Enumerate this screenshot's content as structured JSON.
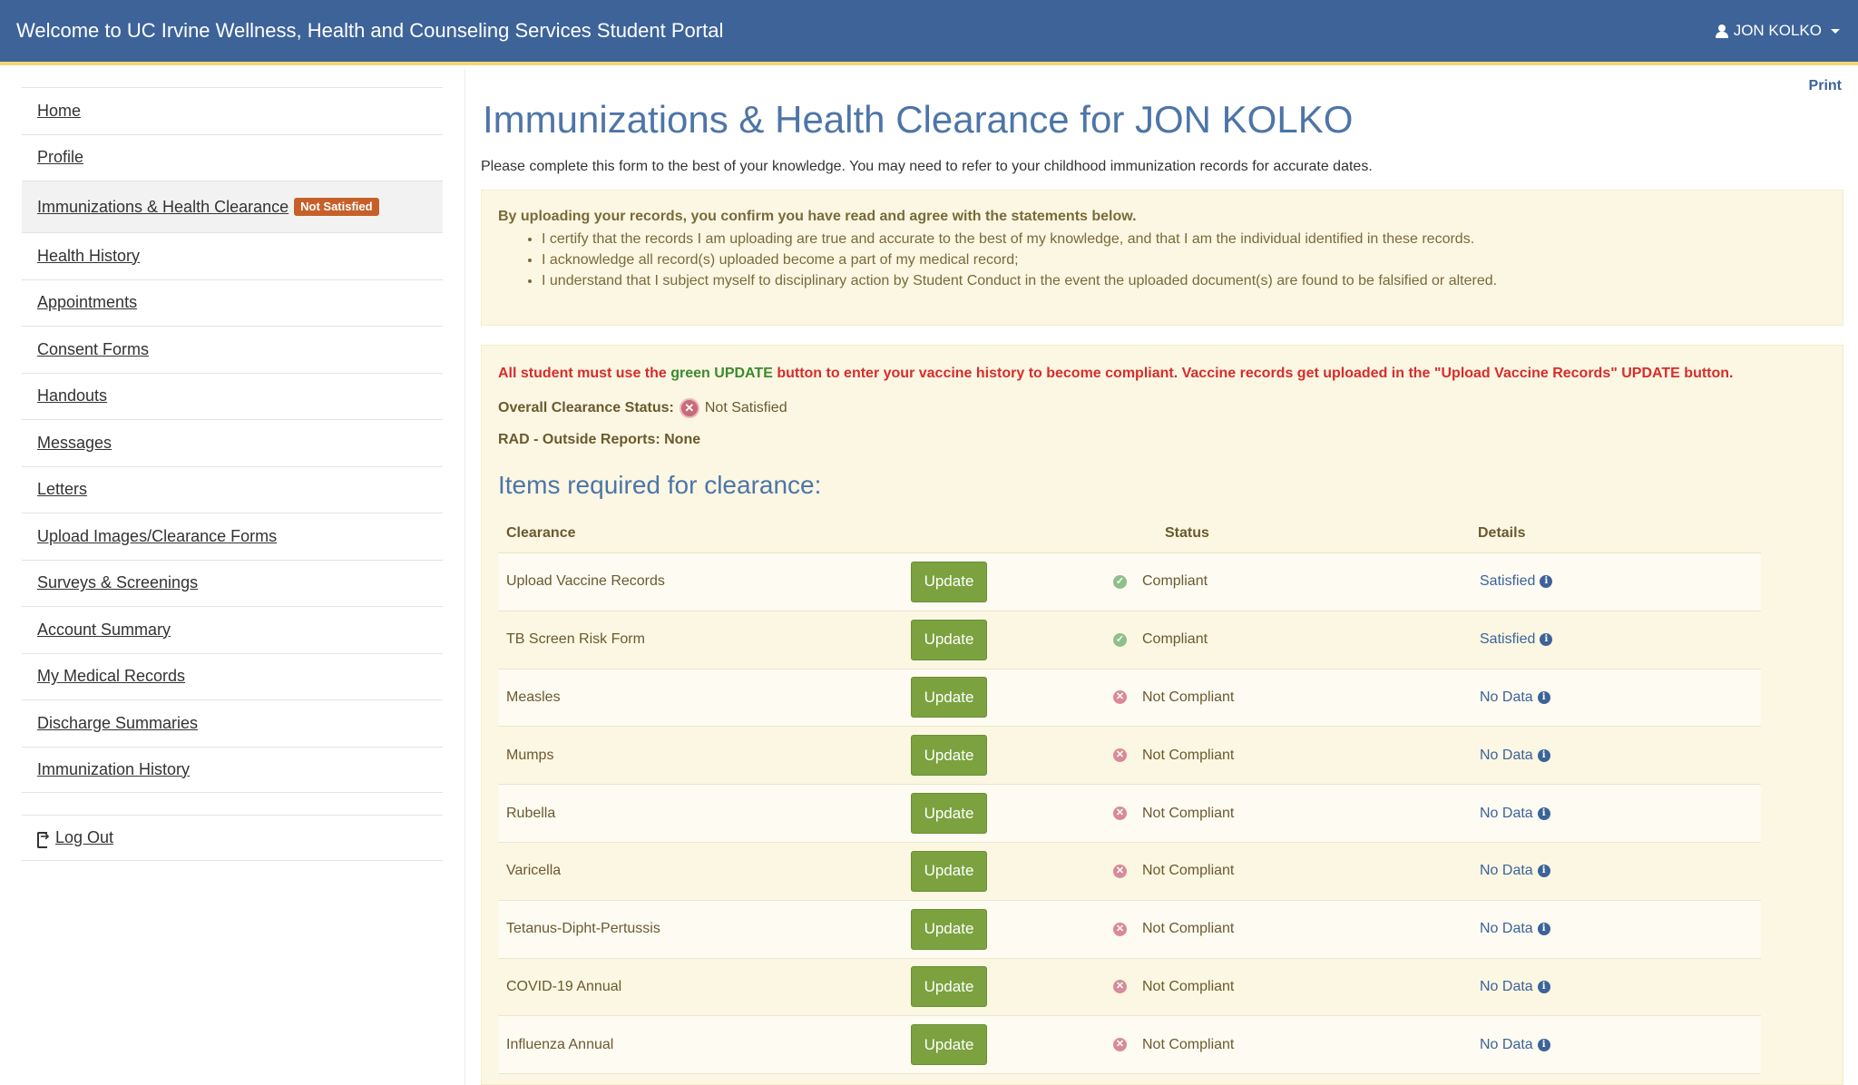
{
  "header": {
    "title": "Welcome to UC Irvine Wellness, Health and Counseling Services Student Portal",
    "user": "JON KOLKO"
  },
  "sidebar": {
    "items": [
      {
        "label": "Home"
      },
      {
        "label": "Profile"
      },
      {
        "label": "Immunizations & Health Clearance",
        "badge": "Not Satisfied"
      },
      {
        "label": "Health History"
      },
      {
        "label": "Appointments"
      },
      {
        "label": "Consent Forms"
      },
      {
        "label": "Handouts"
      },
      {
        "label": "Messages"
      },
      {
        "label": "Letters"
      },
      {
        "label": "Upload Images/Clearance Forms"
      },
      {
        "label": "Surveys & Screenings"
      },
      {
        "label": "Account Summary"
      },
      {
        "label": "My Medical Records"
      },
      {
        "label": "Discharge Summaries"
      },
      {
        "label": "Immunization History"
      }
    ],
    "logout": "Log Out"
  },
  "main": {
    "print": "Print",
    "title": "Immunizations & Health Clearance for JON KOLKO",
    "intro": "Please complete this form to the best of your knowledge. You may need to refer to your childhood immunization records for accurate dates.",
    "agree": {
      "head": "By uploading your records, you confirm you have read and agree with the statements below.",
      "bullets": [
        "I certify that the records I am uploading are true and accurate to the best of my knowledge, and that I am the individual identified in these records.",
        "I acknowledge all record(s) uploaded become a part of my medical record;",
        "I understand that I subject myself to disciplinary action by Student Conduct in the event the uploaded document(s) are found to be falsified or altered."
      ]
    },
    "alert": {
      "part1": "All student must use the",
      "green": "green UPDATE",
      "part2": "button to enter your vaccine history to become compliant. Vaccine records get uploaded in the \"Upload Vaccine Records\" UPDATE button."
    },
    "overall_label": "Overall Clearance Status:",
    "overall_value": "Not Satisfied",
    "rad": "RAD - Outside Reports: None",
    "items_title": "Items required for clearance:",
    "table": {
      "headers": {
        "clearance": "Clearance",
        "status": "Status",
        "details": "Details"
      },
      "button_label": "Update",
      "rows": [
        {
          "name": "Upload Vaccine Records",
          "status": "Compliant",
          "ok": true,
          "details": "Satisfied"
        },
        {
          "name": "TB Screen Risk Form",
          "status": "Compliant",
          "ok": true,
          "details": "Satisfied"
        },
        {
          "name": "Measles",
          "status": "Not Compliant",
          "ok": false,
          "details": "No Data"
        },
        {
          "name": "Mumps",
          "status": "Not Compliant",
          "ok": false,
          "details": "No Data"
        },
        {
          "name": "Rubella",
          "status": "Not Compliant",
          "ok": false,
          "details": "No Data"
        },
        {
          "name": "Varicella",
          "status": "Not Compliant",
          "ok": false,
          "details": "No Data"
        },
        {
          "name": "Tetanus-Dipht-Pertussis",
          "status": "Not Compliant",
          "ok": false,
          "details": "No Data"
        },
        {
          "name": "COVID-19 Annual",
          "status": "Not Compliant",
          "ok": false,
          "details": "No Data"
        },
        {
          "name": "Influenza Annual",
          "status": "Not Compliant",
          "ok": false,
          "details": "No Data"
        }
      ]
    }
  }
}
